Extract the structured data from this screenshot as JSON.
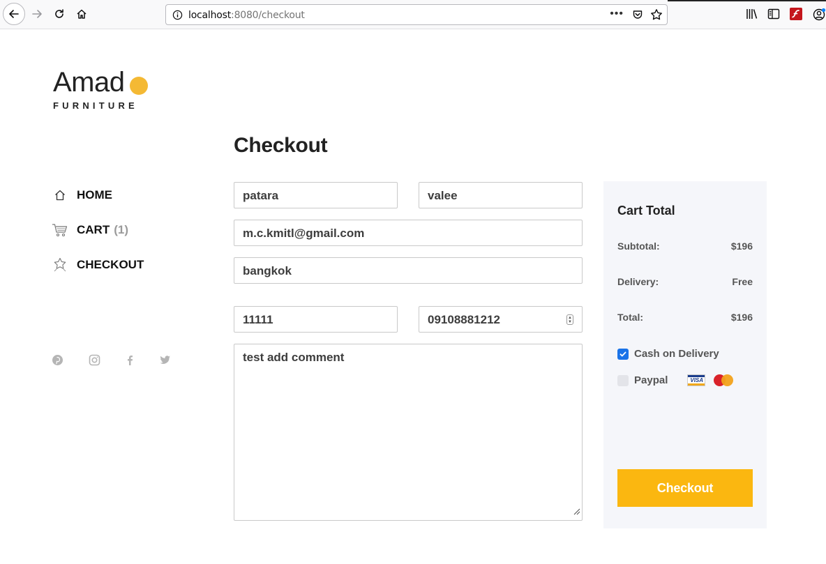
{
  "browser": {
    "url_host": "localhost",
    "url_rest": ":8080/checkout",
    "more_glyph": "•••"
  },
  "brand": {
    "name": "Amado",
    "name_visible": "Amad",
    "tagline": "FURNITURE",
    "accent_color": "#f4b934"
  },
  "sidebar": {
    "items": [
      {
        "label": "HOME",
        "icon": "home-icon"
      },
      {
        "label": "CART",
        "count": "(1)",
        "icon": "cart-icon"
      },
      {
        "label": "CHECKOUT",
        "icon": "star-icon"
      }
    ],
    "social": [
      "pinterest-icon",
      "instagram-icon",
      "facebook-icon",
      "twitter-icon"
    ]
  },
  "checkout": {
    "title": "Checkout",
    "first_name": "patara",
    "last_name": "valee",
    "email": "m.c.kmitl@gmail.com",
    "city": "bangkok",
    "zip": "11111",
    "phone": "09108881212",
    "comment": "test add comment"
  },
  "cart_total": {
    "title": "Cart Total",
    "subtotal_label": "Subtotal:",
    "subtotal_value": "$196",
    "delivery_label": "Delivery:",
    "delivery_value": "Free",
    "total_label": "Total:",
    "total_value": "$196",
    "payment_cod": "Cash on Delivery",
    "payment_cod_checked": true,
    "payment_paypal": "Paypal",
    "payment_paypal_checked": false,
    "visa_text": "VISA",
    "button_label": "Checkout",
    "button_color": "#fbb710"
  }
}
